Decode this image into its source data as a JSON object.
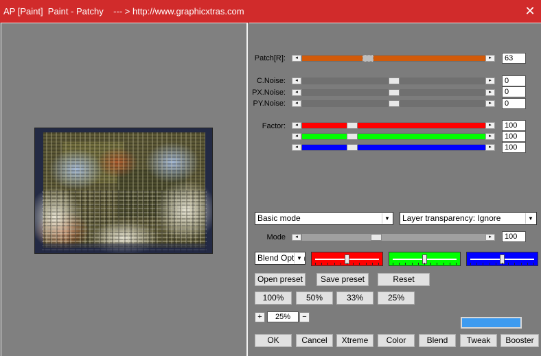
{
  "window": {
    "title": "AP [Paint]  Paint - Patchy    --- > http://www.graphicxtras.com",
    "close_glyph": "✕"
  },
  "sliders": {
    "patch": {
      "label": "Patch[R]:",
      "value": "63",
      "fill_color": "#d25a09",
      "level": 0.35
    },
    "c_noise": {
      "label": "C.Noise:",
      "value": "0",
      "level": 0.5
    },
    "px_noise": {
      "label": "PX.Noise:",
      "value": "0",
      "level": 0.5
    },
    "py_noise": {
      "label": "PY.Noise:",
      "value": "0",
      "level": 0.5
    },
    "factor_label": "Factor:",
    "factor_red": {
      "value": "100",
      "color": "#ff0000",
      "level": 0.26
    },
    "factor_green": {
      "value": "100",
      "color": "#00ff00",
      "level": 0.26
    },
    "factor_blue": {
      "value": "100",
      "color": "#0000ff",
      "level": 0.26
    },
    "mode": {
      "label": "Mode",
      "value": "100",
      "level": 0.4
    }
  },
  "combos": {
    "basic_mode": "Basic mode",
    "layer_transparency": "Layer transparency: Ignore",
    "blend_options": "Blend Options"
  },
  "color_sliders": {
    "red": {
      "color": "#ff0000",
      "level": 0.5
    },
    "green": {
      "color": "#00ff00",
      "level": 0.5
    },
    "blue": {
      "color": "#0000ff",
      "level": 0.5
    }
  },
  "preset_buttons": {
    "open": "Open preset",
    "save": "Save preset",
    "reset": "Reset"
  },
  "zoom_buttons": [
    "100%",
    "50%",
    "33%",
    "25%"
  ],
  "zoom": {
    "plus": "+",
    "value": "25%",
    "minus": "−"
  },
  "accent_swatch": "#3d9bf0",
  "bottom_buttons": {
    "ok": "OK",
    "cancel": "Cancel",
    "xtreme": "Xtreme",
    "color": "Color",
    "blend": "Blend",
    "tweak": "Tweak",
    "booster": "Booster"
  }
}
